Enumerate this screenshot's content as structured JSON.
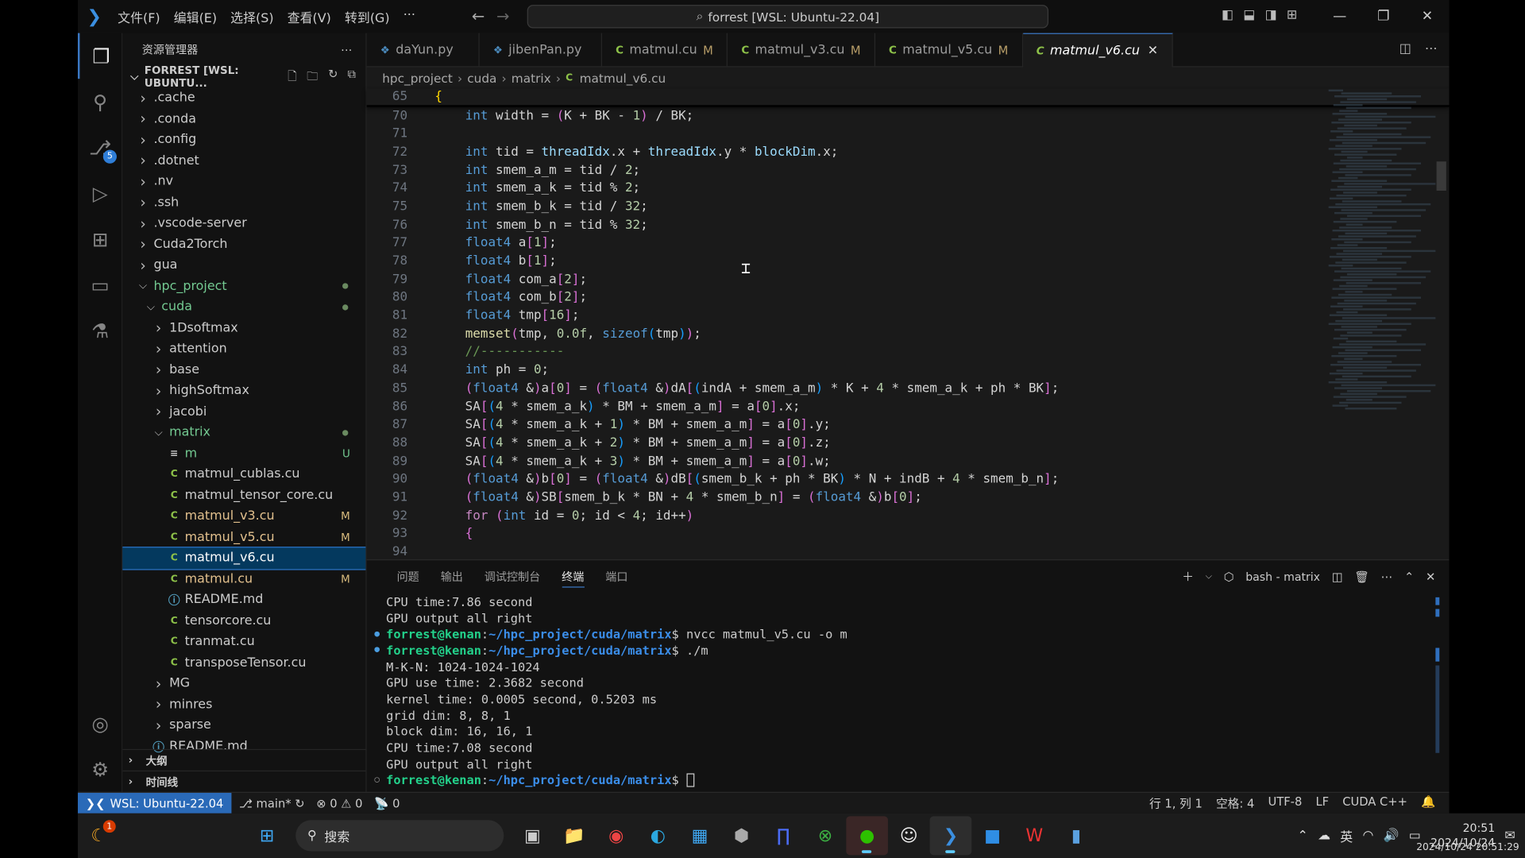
{
  "titlebar": {
    "menu": [
      "文件(F)",
      "编辑(E)",
      "选择(S)",
      "查看(V)",
      "转到(G)",
      "···"
    ],
    "command_center": "forrest [WSL: Ubuntu-22.04]"
  },
  "activity_bar": {
    "source_control_badge": "5"
  },
  "sidebar": {
    "title": "资源管理器",
    "root": "FORREST [WSL: UBUNTU...",
    "items": [
      {
        "label": ".cache",
        "depth": 0,
        "kind": "folder",
        "open": false
      },
      {
        "label": ".conda",
        "depth": 0,
        "kind": "folder",
        "open": false
      },
      {
        "label": ".config",
        "depth": 0,
        "kind": "folder",
        "open": false
      },
      {
        "label": ".dotnet",
        "depth": 0,
        "kind": "folder",
        "open": false
      },
      {
        "label": ".nv",
        "depth": 0,
        "kind": "folder",
        "open": false
      },
      {
        "label": ".ssh",
        "depth": 0,
        "kind": "folder",
        "open": false
      },
      {
        "label": ".vscode-server",
        "depth": 0,
        "kind": "folder",
        "open": false
      },
      {
        "label": "Cuda2Torch",
        "depth": 0,
        "kind": "folder",
        "open": false
      },
      {
        "label": "gua",
        "depth": 0,
        "kind": "folder",
        "open": false
      },
      {
        "label": "hpc_project",
        "depth": 0,
        "kind": "folder",
        "open": true,
        "state": "green-dot"
      },
      {
        "label": "cuda",
        "depth": 1,
        "kind": "folder",
        "open": true,
        "state": "green-dot"
      },
      {
        "label": "1Dsoftmax",
        "depth": 2,
        "kind": "folder",
        "open": false
      },
      {
        "label": "attention",
        "depth": 2,
        "kind": "folder",
        "open": false
      },
      {
        "label": "base",
        "depth": 2,
        "kind": "folder",
        "open": false
      },
      {
        "label": "highSoftmax",
        "depth": 2,
        "kind": "folder",
        "open": false
      },
      {
        "label": "jacobi",
        "depth": 2,
        "kind": "folder",
        "open": false
      },
      {
        "label": "matrix",
        "depth": 2,
        "kind": "folder",
        "open": true,
        "state": "green-dot"
      },
      {
        "label": "m",
        "depth": 3,
        "kind": "binary",
        "status": "U",
        "state": "green"
      },
      {
        "label": "matmul_cublas.cu",
        "depth": 3,
        "kind": "cu"
      },
      {
        "label": "matmul_tensor_core.cu",
        "depth": 3,
        "kind": "cu"
      },
      {
        "label": "matmul_v3.cu",
        "depth": 3,
        "kind": "cu",
        "status": "M",
        "state": "mod"
      },
      {
        "label": "matmul_v5.cu",
        "depth": 3,
        "kind": "cu",
        "status": "M",
        "state": "mod"
      },
      {
        "label": "matmul_v6.cu",
        "depth": 3,
        "kind": "cu",
        "state": "selected"
      },
      {
        "label": "matmul.cu",
        "depth": 3,
        "kind": "cu",
        "status": "M",
        "state": "mod"
      },
      {
        "label": "README.md",
        "depth": 3,
        "kind": "info"
      },
      {
        "label": "tensorcore.cu",
        "depth": 3,
        "kind": "cu"
      },
      {
        "label": "tranmat.cu",
        "depth": 3,
        "kind": "cu"
      },
      {
        "label": "transposeTensor.cu",
        "depth": 3,
        "kind": "cu"
      },
      {
        "label": "MG",
        "depth": 2,
        "kind": "folder",
        "open": false
      },
      {
        "label": "minres",
        "depth": 2,
        "kind": "folder",
        "open": false
      },
      {
        "label": "sparse",
        "depth": 2,
        "kind": "folder",
        "open": false
      },
      {
        "label": "README.md",
        "depth": 1,
        "kind": "info"
      }
    ],
    "sections": [
      "大纲",
      "时间线"
    ]
  },
  "tabs": [
    {
      "label": "daYun.py",
      "type": "py",
      "modified": false
    },
    {
      "label": "jibenPan.py",
      "type": "py",
      "modified": false
    },
    {
      "label": "matmul.cu",
      "type": "cu",
      "modified": true
    },
    {
      "label": "matmul_v3.cu",
      "type": "cu",
      "modified": true
    },
    {
      "label": "matmul_v5.cu",
      "type": "cu",
      "modified": true
    },
    {
      "label": "matmul_v6.cu",
      "type": "cu",
      "modified": false,
      "active": true
    }
  ],
  "modified_marker": "M",
  "breadcrumb": [
    "hpc_project",
    "cuda",
    "matrix",
    "matmul_v6.cu"
  ],
  "code": {
    "sticky": {
      "num": "65",
      "text": "{"
    },
    "lines": [
      {
        "num": "70",
        "text": "    int width = (K + BK - 1) / BK;"
      },
      {
        "num": "71",
        "text": ""
      },
      {
        "num": "72",
        "text": "    int tid = threadIdx.x + threadIdx.y * blockDim.x;"
      },
      {
        "num": "73",
        "text": "    int smem_a_m = tid / 2;"
      },
      {
        "num": "74",
        "text": "    int smem_a_k = tid % 2;"
      },
      {
        "num": "75",
        "text": "    int smem_b_k = tid / 32;"
      },
      {
        "num": "76",
        "text": "    int smem_b_n = tid % 32;"
      },
      {
        "num": "77",
        "text": "    float4 a[1];"
      },
      {
        "num": "78",
        "text": "    float4 b[1];"
      },
      {
        "num": "79",
        "text": "    float4 com_a[2];"
      },
      {
        "num": "80",
        "text": "    float4 com_b[2];"
      },
      {
        "num": "81",
        "text": "    float4 tmp[16];"
      },
      {
        "num": "82",
        "text": "    memset(tmp, 0.0f, sizeof(tmp));"
      },
      {
        "num": "83",
        "text": "    //-----------"
      },
      {
        "num": "84",
        "text": "    int ph = 0;"
      },
      {
        "num": "85",
        "text": "    (float4 &)a[0] = (float4 &)dA[(indA + smem_a_m) * K + 4 * smem_a_k + ph * BK];"
      },
      {
        "num": "86",
        "text": "    SA[(4 * smem_a_k) * BM + smem_a_m] = a[0].x;"
      },
      {
        "num": "87",
        "text": "    SA[(4 * smem_a_k + 1) * BM + smem_a_m] = a[0].y;"
      },
      {
        "num": "88",
        "text": "    SA[(4 * smem_a_k + 2) * BM + smem_a_m] = a[0].z;"
      },
      {
        "num": "89",
        "text": "    SA[(4 * smem_a_k + 3) * BM + smem_a_m] = a[0].w;"
      },
      {
        "num": "90",
        "text": "    (float4 &)b[0] = (float4 &)dB[(smem_b_k + ph * BK) * N + indB + 4 * smem_b_n];"
      },
      {
        "num": "91",
        "text": "    (float4 &)SB[smem_b_k * BN + 4 * smem_b_n] = (float4 &)b[0];"
      },
      {
        "num": "92",
        "text": "    for (int id = 0; id < 4; id++)"
      },
      {
        "num": "93",
        "text": "    {"
      },
      {
        "num": "94",
        "text": ""
      }
    ]
  },
  "panel": {
    "tabs": [
      "问题",
      "输出",
      "调试控制台",
      "终端",
      "端口"
    ],
    "active_tab": "终端",
    "terminal_name": "bash - matrix",
    "lines": [
      {
        "type": "out",
        "text": "CPU time:7.86 second"
      },
      {
        "type": "out",
        "text": "GPU output all right"
      },
      {
        "type": "prompt",
        "user": "forrest@kenan",
        "path": "~/hpc_project/cuda/matrix",
        "cmd": "$ nvcc matmul_v5.cu -o m"
      },
      {
        "type": "prompt",
        "user": "forrest@kenan",
        "path": "~/hpc_project/cuda/matrix",
        "cmd": "$ ./m"
      },
      {
        "type": "out",
        "text": "M-K-N: 1024-1024-1024"
      },
      {
        "type": "out",
        "text": "GPU use time: 2.3682 second"
      },
      {
        "type": "out",
        "text": "kernel time: 0.0005 second, 0.5203 ms"
      },
      {
        "type": "out",
        "text": "grid dim: 8, 8, 1"
      },
      {
        "type": "out",
        "text": "block dim: 16, 16, 1"
      },
      {
        "type": "out",
        "text": "CPU time:7.08 second"
      },
      {
        "type": "out",
        "text": "GPU output all right"
      },
      {
        "type": "prompt-active",
        "user": "forrest@kenan",
        "path": "~/hpc_project/cuda/matrix",
        "cmd": "$ "
      }
    ]
  },
  "statusbar": {
    "remote": "WSL: Ubuntu-22.04",
    "branch": "main*",
    "errors": "0",
    "warnings": "0",
    "ports": "0",
    "position": "行 1, 列 1",
    "spaces": "空格: 4",
    "encoding": "UTF-8",
    "eol": "LF",
    "language": "CUDA C++"
  },
  "taskbar": {
    "search_placeholder": "搜索",
    "notification_badge": "1",
    "ime": "英",
    "time": "20:51",
    "date": "2024/10/24"
  },
  "watermark": "2024/10/24 20:51:29"
}
